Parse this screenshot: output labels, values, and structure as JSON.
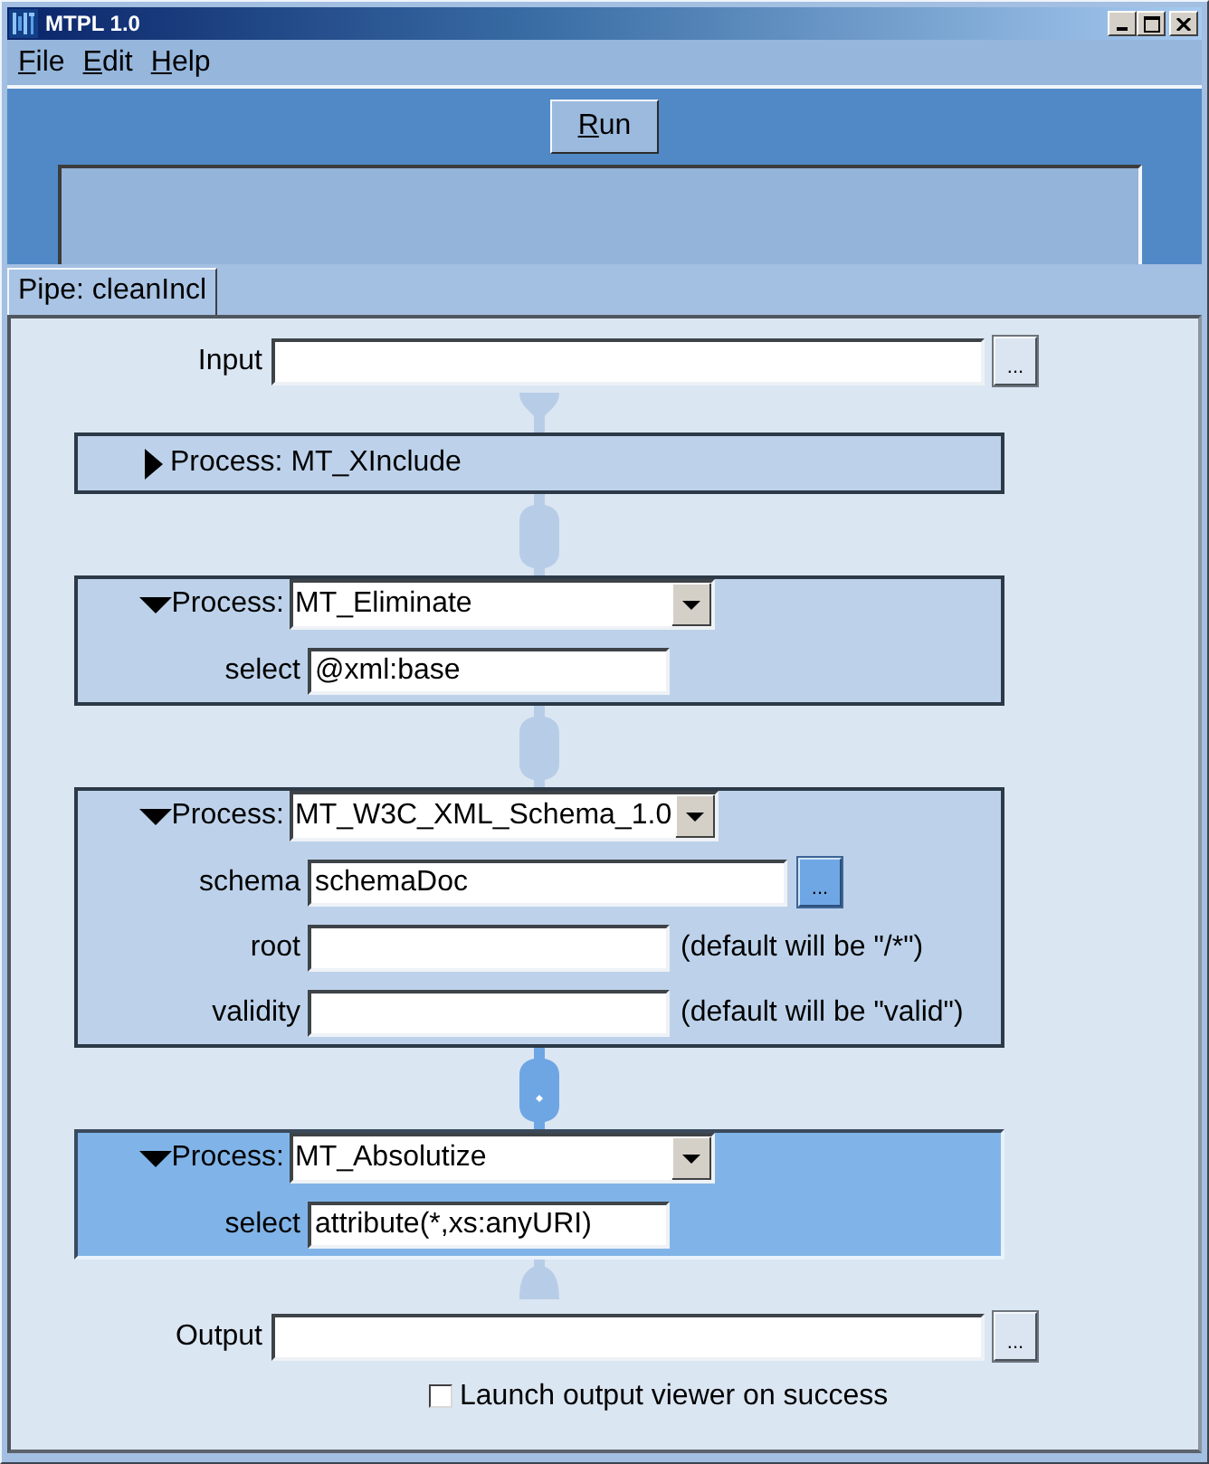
{
  "window": {
    "title": "MTPL 1.0"
  },
  "menu": [
    {
      "label": "File",
      "mnemonic": true
    },
    {
      "label": "Edit",
      "mnemonic": true
    },
    {
      "label": "Help",
      "mnemonic": true
    }
  ],
  "toolbar": {
    "run_button": {
      "label": "Run",
      "mnemonic": true
    }
  },
  "tabs": [
    {
      "label": "Pipe: cleanIncl",
      "selected": true
    }
  ],
  "pipe": {
    "input": {
      "label": "Input",
      "browse": {
        "label": "...",
        "highlighted": false
      }
    },
    "processes": [
      {
        "expanded": false,
        "selected": false,
        "title": "Process: MT_XInclude"
      },
      {
        "expanded": true,
        "selected": false,
        "label": "Process:",
        "value": "MT_Eliminate",
        "params": [
          {
            "label": "select",
            "value": "@xml:base"
          }
        ]
      },
      {
        "expanded": true,
        "selected": false,
        "label": "Process:",
        "value": "MT_W3C_XML_Schema_1.0",
        "params": [
          {
            "label": "schema",
            "value": "schemaDoc",
            "browse": {
              "label": "...",
              "highlighted": true
            }
          },
          {
            "label": "root",
            "note": "(default will be \"/*\")"
          },
          {
            "label": "validity",
            "note": "(default will be \"valid\")"
          }
        ]
      },
      {
        "expanded": true,
        "selected": true,
        "label": "Process:",
        "value": "MT_Absolutize",
        "params": [
          {
            "label": "select",
            "value": "attribute(*,xs:anyURI)"
          }
        ]
      }
    ],
    "output": {
      "label": "Output",
      "browse": {
        "label": "...",
        "highlighted": false
      }
    },
    "launch_viewer": {
      "label": "Launch output viewer on success",
      "checked": false
    }
  }
}
